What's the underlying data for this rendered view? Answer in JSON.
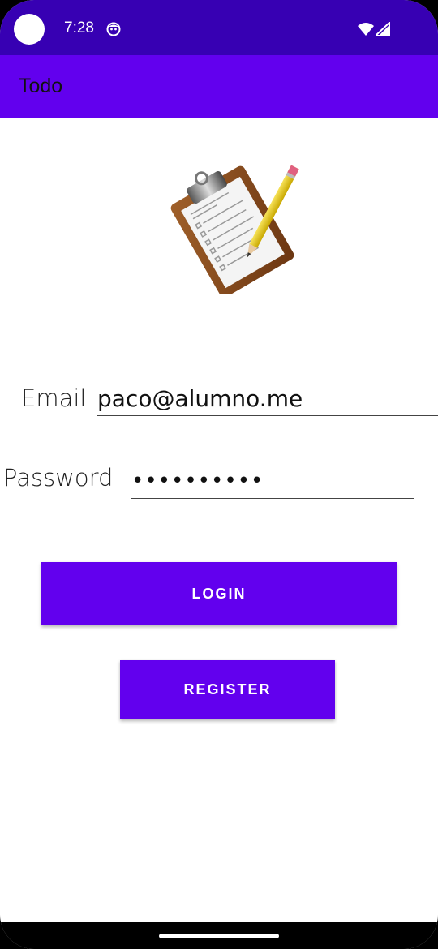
{
  "status_bar": {
    "time": "7:28",
    "background": "#3700B3",
    "icons": [
      "notification-icon",
      "wifi-icon",
      "signal-icon"
    ]
  },
  "app_bar": {
    "title": "Todo",
    "background": "#6200EE"
  },
  "logo": {
    "icon": "clipboard-pencil-icon"
  },
  "form": {
    "email_label": "Email",
    "email_value": "paco@alumno.me",
    "password_label": "Password",
    "password_value": "••••••••••"
  },
  "buttons": {
    "login_label": "LOGIN",
    "register_label": "REGISTER",
    "accent": "#6200EE"
  }
}
